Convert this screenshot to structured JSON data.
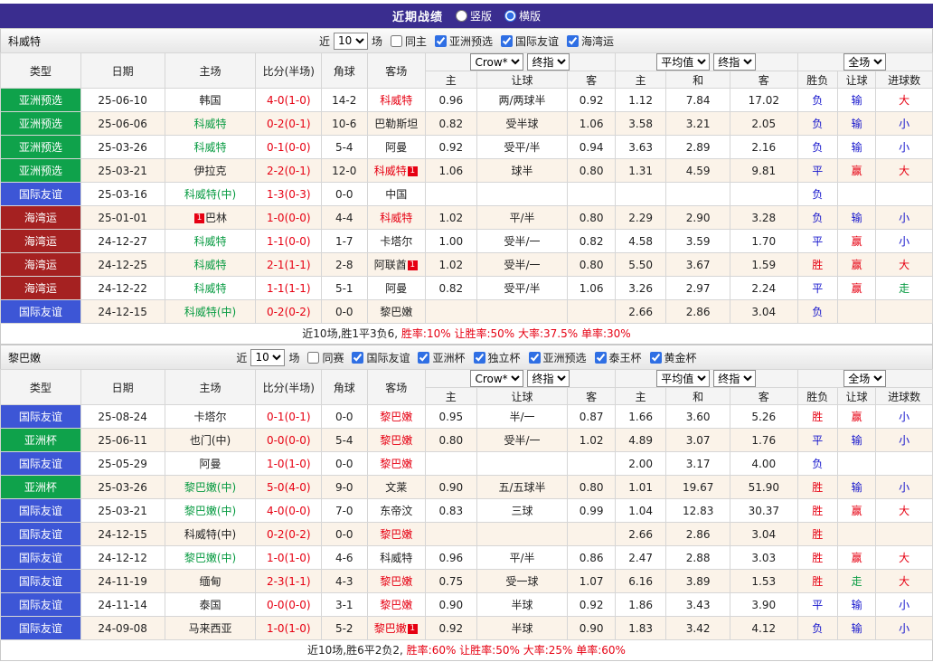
{
  "topbar": {
    "title": "近期战绩",
    "radio_vertical": "竖版",
    "radio_horizontal": "横版"
  },
  "colors": {
    "topbar_bg": "#3A2D8F",
    "badge_green": "#0FA24B",
    "badge_blue": "#3D56D6",
    "badge_maroon": "#A52121",
    "win_red": "#E60012",
    "lose_blue": "#1414CC",
    "push_green": "#089B42"
  },
  "table_header": {
    "col_type": "类型",
    "col_date": "日期",
    "col_home": "主场",
    "col_score": "比分(半场)",
    "col_corner": "角球",
    "col_away": "客场",
    "odds_company": "Crow*",
    "final_odds": "终指",
    "average": "平均值",
    "scope": "全场",
    "sub": [
      "主",
      "让球",
      "客",
      "主",
      "和",
      "客",
      "胜负",
      "让球",
      "进球数"
    ]
  },
  "sections": [
    {
      "team": "科威特",
      "filter": {
        "near_label": "近",
        "count": "10",
        "games_label": "场",
        "checkboxes": [
          {
            "label": "同主",
            "checked": false
          },
          {
            "label": "亚洲预选",
            "checked": true
          },
          {
            "label": "国际友谊",
            "checked": true
          },
          {
            "label": "海湾运",
            "checked": true
          }
        ]
      },
      "rows": [
        {
          "type": "亚洲预选",
          "type_color": "green",
          "date": "25-06-10",
          "home": "韩国",
          "home_color": "black",
          "score": "4-0(1-0)",
          "corner": "14-2",
          "away": "科威特",
          "away_color": "red",
          "odds": [
            "0.96",
            "两/两球半",
            "0.92"
          ],
          "avg": [
            "1.12",
            "7.84",
            "17.02"
          ],
          "result": "负",
          "result_color": "blue",
          "handicap": "输",
          "handicap_color": "blue",
          "goals": "大",
          "goals_color": "red"
        },
        {
          "type": "亚洲预选",
          "type_color": "green",
          "date": "25-06-06",
          "home": "科威特",
          "home_color": "green",
          "score": "0-2(0-1)",
          "corner": "10-6",
          "away": "巴勒斯坦",
          "away_color": "black",
          "odds": [
            "0.82",
            "受半球",
            "1.06"
          ],
          "avg": [
            "3.58",
            "3.21",
            "2.05"
          ],
          "result": "负",
          "result_color": "blue",
          "handicap": "输",
          "handicap_color": "blue",
          "goals": "小",
          "goals_color": "blue"
        },
        {
          "type": "亚洲预选",
          "type_color": "green",
          "date": "25-03-26",
          "home": "科威特",
          "home_color": "green",
          "score": "0-1(0-0)",
          "corner": "5-4",
          "away": "阿曼",
          "away_color": "black",
          "odds": [
            "0.92",
            "受平/半",
            "0.94"
          ],
          "avg": [
            "3.63",
            "2.89",
            "2.16"
          ],
          "result": "负",
          "result_color": "blue",
          "handicap": "输",
          "handicap_color": "blue",
          "goals": "小",
          "goals_color": "blue"
        },
        {
          "type": "亚洲预选",
          "type_color": "green",
          "date": "25-03-21",
          "home": "伊拉克",
          "home_color": "black",
          "score": "2-2(0-1)",
          "corner": "12-0",
          "away": "科威特",
          "away_color": "red",
          "away_badge": "1",
          "odds": [
            "1.06",
            "球半",
            "0.80"
          ],
          "avg": [
            "1.31",
            "4.59",
            "9.81"
          ],
          "result": "平",
          "result_color": "blue",
          "handicap": "赢",
          "handicap_color": "red",
          "goals": "大",
          "goals_color": "red"
        },
        {
          "type": "国际友谊",
          "type_color": "blue",
          "date": "25-03-16",
          "home": "科威特(中)",
          "home_color": "green",
          "score": "1-3(0-3)",
          "corner": "0-0",
          "away": "中国",
          "away_color": "black",
          "odds": [
            "",
            "",
            ""
          ],
          "avg": [
            "",
            "",
            ""
          ],
          "result": "负",
          "result_color": "blue",
          "handicap": "",
          "handicap_color": "black",
          "goals": "",
          "goals_color": "black"
        },
        {
          "type": "海湾运",
          "type_color": "maroon",
          "date": "25-01-01",
          "home": "巴林",
          "home_color": "black",
          "home_badge_pre": "1",
          "score": "1-0(0-0)",
          "corner": "4-4",
          "away": "科威特",
          "away_color": "red",
          "odds": [
            "1.02",
            "平/半",
            "0.80"
          ],
          "avg": [
            "2.29",
            "2.90",
            "3.28"
          ],
          "result": "负",
          "result_color": "blue",
          "handicap": "输",
          "handicap_color": "blue",
          "goals": "小",
          "goals_color": "blue"
        },
        {
          "type": "海湾运",
          "type_color": "maroon",
          "date": "24-12-27",
          "home": "科威特",
          "home_color": "green",
          "score": "1-1(0-0)",
          "corner": "1-7",
          "away": "卡塔尔",
          "away_color": "black",
          "odds": [
            "1.00",
            "受半/一",
            "0.82"
          ],
          "avg": [
            "4.58",
            "3.59",
            "1.70"
          ],
          "result": "平",
          "result_color": "blue",
          "handicap": "赢",
          "handicap_color": "red",
          "goals": "小",
          "goals_color": "blue"
        },
        {
          "type": "海湾运",
          "type_color": "maroon",
          "date": "24-12-25",
          "home": "科威特",
          "home_color": "green",
          "score": "2-1(1-1)",
          "corner": "2-8",
          "away": "阿联酋",
          "away_color": "black",
          "away_badge": "1",
          "odds": [
            "1.02",
            "受半/一",
            "0.80"
          ],
          "avg": [
            "5.50",
            "3.67",
            "1.59"
          ],
          "result": "胜",
          "result_color": "red",
          "handicap": "赢",
          "handicap_color": "red",
          "goals": "大",
          "goals_color": "red"
        },
        {
          "type": "海湾运",
          "type_color": "maroon",
          "date": "24-12-22",
          "home": "科威特",
          "home_color": "green",
          "score": "1-1(1-1)",
          "corner": "5-1",
          "away": "阿曼",
          "away_color": "black",
          "odds": [
            "0.82",
            "受平/半",
            "1.06"
          ],
          "avg": [
            "3.26",
            "2.97",
            "2.24"
          ],
          "result": "平",
          "result_color": "blue",
          "handicap": "赢",
          "handicap_color": "red",
          "goals": "走",
          "goals_color": "green"
        },
        {
          "type": "国际友谊",
          "type_color": "blue",
          "date": "24-12-15",
          "home": "科威特(中)",
          "home_color": "green",
          "score": "0-2(0-2)",
          "corner": "0-0",
          "away": "黎巴嫩",
          "away_color": "black",
          "odds": [
            "",
            "",
            ""
          ],
          "avg": [
            "2.66",
            "2.86",
            "3.04"
          ],
          "result": "负",
          "result_color": "blue",
          "handicap": "",
          "handicap_color": "black",
          "goals": "",
          "goals_color": "black"
        }
      ],
      "summary_prefix": "近10场,胜1平3负6, ",
      "summary_stats": "胜率:10% 让胜率:50% 大率:37.5% 单率:30%"
    },
    {
      "team": "黎巴嫩",
      "filter": {
        "near_label": "近",
        "count": "10",
        "games_label": "场",
        "checkboxes": [
          {
            "label": "同赛",
            "checked": false
          },
          {
            "label": "国际友谊",
            "checked": true
          },
          {
            "label": "亚洲杯",
            "checked": true
          },
          {
            "label": "独立杯",
            "checked": true
          },
          {
            "label": "亚洲预选",
            "checked": true
          },
          {
            "label": "泰王杯",
            "checked": true
          },
          {
            "label": "黄金杯",
            "checked": true
          }
        ]
      },
      "rows": [
        {
          "type": "国际友谊",
          "type_color": "blue",
          "date": "25-08-24",
          "home": "卡塔尔",
          "home_color": "black",
          "score": "0-1(0-1)",
          "corner": "0-0",
          "away": "黎巴嫩",
          "away_color": "red",
          "odds": [
            "0.95",
            "半/一",
            "0.87"
          ],
          "avg": [
            "1.66",
            "3.60",
            "5.26"
          ],
          "result": "胜",
          "result_color": "red",
          "handicap": "赢",
          "handicap_color": "red",
          "goals": "小",
          "goals_color": "blue"
        },
        {
          "type": "亚洲杯",
          "type_color": "green",
          "date": "25-06-11",
          "home": "也门(中)",
          "home_color": "black",
          "score": "0-0(0-0)",
          "corner": "5-4",
          "away": "黎巴嫩",
          "away_color": "red",
          "odds": [
            "0.80",
            "受半/一",
            "1.02"
          ],
          "avg": [
            "4.89",
            "3.07",
            "1.76"
          ],
          "result": "平",
          "result_color": "blue",
          "handicap": "输",
          "handicap_color": "blue",
          "goals": "小",
          "goals_color": "blue"
        },
        {
          "type": "国际友谊",
          "type_color": "blue",
          "date": "25-05-29",
          "home": "阿曼",
          "home_color": "black",
          "score": "1-0(1-0)",
          "corner": "0-0",
          "away": "黎巴嫩",
          "away_color": "red",
          "odds": [
            "",
            "",
            ""
          ],
          "avg": [
            "2.00",
            "3.17",
            "4.00"
          ],
          "result": "负",
          "result_color": "blue",
          "handicap": "",
          "handicap_color": "black",
          "goals": "",
          "goals_color": "black"
        },
        {
          "type": "亚洲杯",
          "type_color": "green",
          "date": "25-03-26",
          "home": "黎巴嫩(中)",
          "home_color": "green",
          "score": "5-0(4-0)",
          "corner": "9-0",
          "away": "文莱",
          "away_color": "black",
          "odds": [
            "0.90",
            "五/五球半",
            "0.80"
          ],
          "avg": [
            "1.01",
            "19.67",
            "51.90"
          ],
          "result": "胜",
          "result_color": "red",
          "handicap": "输",
          "handicap_color": "blue",
          "goals": "小",
          "goals_color": "blue"
        },
        {
          "type": "国际友谊",
          "type_color": "blue",
          "date": "25-03-21",
          "home": "黎巴嫩(中)",
          "home_color": "green",
          "score": "4-0(0-0)",
          "corner": "7-0",
          "away": "东帝汶",
          "away_color": "black",
          "odds": [
            "0.83",
            "三球",
            "0.99"
          ],
          "avg": [
            "1.04",
            "12.83",
            "30.37"
          ],
          "result": "胜",
          "result_color": "red",
          "handicap": "赢",
          "handicap_color": "red",
          "goals": "大",
          "goals_color": "red"
        },
        {
          "type": "国际友谊",
          "type_color": "blue",
          "date": "24-12-15",
          "home": "科威特(中)",
          "home_color": "black",
          "score": "0-2(0-2)",
          "corner": "0-0",
          "away": "黎巴嫩",
          "away_color": "red",
          "odds": [
            "",
            "",
            ""
          ],
          "avg": [
            "2.66",
            "2.86",
            "3.04"
          ],
          "result": "胜",
          "result_color": "red",
          "handicap": "",
          "handicap_color": "black",
          "goals": "",
          "goals_color": "black"
        },
        {
          "type": "国际友谊",
          "type_color": "blue",
          "date": "24-12-12",
          "home": "黎巴嫩(中)",
          "home_color": "green",
          "score": "1-0(1-0)",
          "corner": "4-6",
          "away": "科威特",
          "away_color": "black",
          "odds": [
            "0.96",
            "平/半",
            "0.86"
          ],
          "avg": [
            "2.47",
            "2.88",
            "3.03"
          ],
          "result": "胜",
          "result_color": "red",
          "handicap": "赢",
          "handicap_color": "red",
          "goals": "大",
          "goals_color": "red"
        },
        {
          "type": "国际友谊",
          "type_color": "blue",
          "date": "24-11-19",
          "home": "缅甸",
          "home_color": "black",
          "score": "2-3(1-1)",
          "corner": "4-3",
          "away": "黎巴嫩",
          "away_color": "red",
          "odds": [
            "0.75",
            "受一球",
            "1.07"
          ],
          "avg": [
            "6.16",
            "3.89",
            "1.53"
          ],
          "result": "胜",
          "result_color": "red",
          "handicap": "走",
          "handicap_color": "green",
          "goals": "大",
          "goals_color": "red"
        },
        {
          "type": "国际友谊",
          "type_color": "blue",
          "date": "24-11-14",
          "home": "泰国",
          "home_color": "black",
          "score": "0-0(0-0)",
          "corner": "3-1",
          "away": "黎巴嫩",
          "away_color": "red",
          "odds": [
            "0.90",
            "半球",
            "0.92"
          ],
          "avg": [
            "1.86",
            "3.43",
            "3.90"
          ],
          "result": "平",
          "result_color": "blue",
          "handicap": "输",
          "handicap_color": "blue",
          "goals": "小",
          "goals_color": "blue"
        },
        {
          "type": "国际友谊",
          "type_color": "blue",
          "date": "24-09-08",
          "home": "马来西亚",
          "home_color": "black",
          "score": "1-0(1-0)",
          "corner": "5-2",
          "away": "黎巴嫩",
          "away_color": "red",
          "away_badge": "1",
          "odds": [
            "0.92",
            "半球",
            "0.90"
          ],
          "avg": [
            "1.83",
            "3.42",
            "4.12"
          ],
          "result": "负",
          "result_color": "blue",
          "handicap": "输",
          "handicap_color": "blue",
          "goals": "小",
          "goals_color": "blue"
        }
      ],
      "summary_prefix": "近10场,胜6平2负2, ",
      "summary_stats": "胜率:60% 让胜率:50% 大率:25% 单率:60%"
    }
  ]
}
